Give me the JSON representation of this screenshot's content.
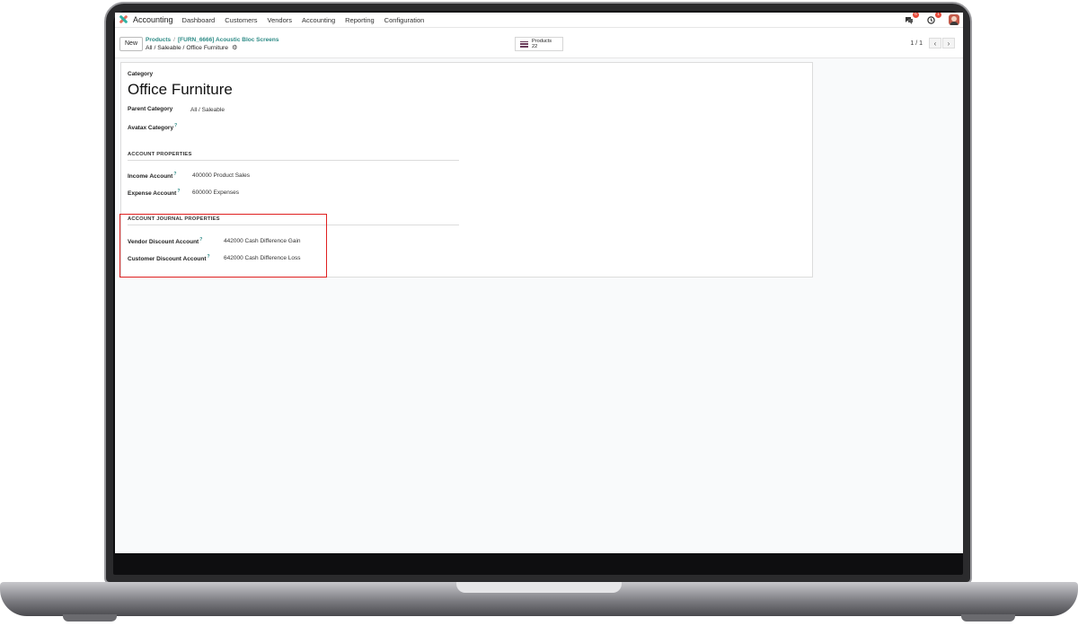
{
  "navbar": {
    "app_name": "Accounting",
    "menu": [
      "Dashboard",
      "Customers",
      "Vendors",
      "Accounting",
      "Reporting",
      "Configuration"
    ],
    "messages_count": "6",
    "activities_count": "1"
  },
  "control_panel": {
    "new_label": "New",
    "breadcrumb": [
      "Products",
      "[FURN_6666] Acoustic Bloc Screens"
    ],
    "breadcrumb_sep": "/",
    "record_title": "All / Saleable / Office Furniture",
    "smart_button": {
      "label": "Products",
      "count": "22"
    },
    "pager": {
      "value": "1 / 1",
      "prev": "‹",
      "next": "›"
    }
  },
  "form": {
    "category_label": "Category",
    "category_name": "Office Furniture",
    "parent_category_label": "Parent Category",
    "parent_category_value": "All / Saleable",
    "avatax_category_label": "Avatax Category",
    "help_mark": "?",
    "account_properties": {
      "title": "ACCOUNT PROPERTIES",
      "income_label": "Income Account",
      "income_value": "400000 Product Sales",
      "expense_label": "Expense Account",
      "expense_value": "600000 Expenses"
    },
    "journal_properties": {
      "title": "ACCOUNT JOURNAL PROPERTIES",
      "vendor_discount_label": "Vendor Discount Account",
      "vendor_discount_value": "442000 Cash Difference Gain",
      "customer_discount_label": "Customer Discount Account",
      "customer_discount_value": "642000 Cash Difference Loss"
    }
  },
  "colors": {
    "accent": "#2c8a85",
    "highlight": "#e02020",
    "brand": "#6b3d5c"
  }
}
